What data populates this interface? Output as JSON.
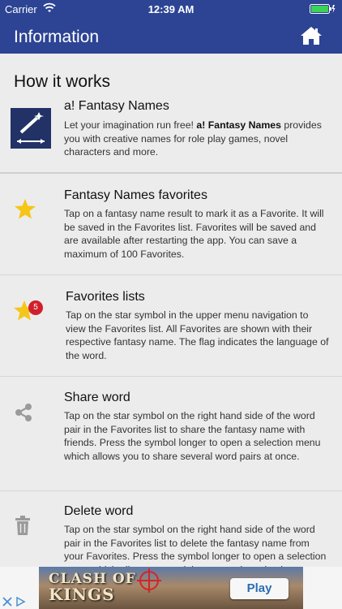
{
  "status": {
    "carrier": "Carrier",
    "time": "12:39 AM"
  },
  "nav": {
    "title": "Information",
    "home_icon": "home-icon"
  },
  "section_title": "How it works",
  "items": [
    {
      "icon": "magic-wand-app-icon",
      "heading": "a! Fantasy Names",
      "body_before": "Let your imagination run free! ",
      "body_bold": "a! Fantasy Names",
      "body_after": " provides you with creative names for role play games, novel characters and more."
    },
    {
      "icon": "star-icon",
      "heading": "Fantasy Names favorites",
      "body": "Tap on a fantasy name result to mark it as a Favorite. It will be saved in the Favorites list. Favorites will be saved and are available after restarting the app. You can save a maximum of 100 Favorites."
    },
    {
      "icon": "star-badge-icon",
      "badge": "5",
      "heading": "Favorites lists",
      "body": "Tap on the star symbol in the upper menu navigation to view the Favorites list. All Favorites are shown with their respective fantasy name. The flag indicates the language of the word."
    },
    {
      "icon": "share-icon",
      "heading": "Share word",
      "body": "Tap on the star symbol on the right hand side of the word pair in the Favorites list to share the fantasy name with friends. Press the symbol longer to open a selection menu which allows you to share several word pairs at once."
    },
    {
      "icon": "trash-icon",
      "heading": "Delete word",
      "body": "Tap on the star symbol on the right hand side of the word pair in the Favorites list to delete the fantasy name from your Favorites. Press the symbol longer to open a selection menu which allows you to delete several word pairs at once."
    }
  ],
  "ad": {
    "game_line1": "CLASH OF",
    "game_line2": "KINGS",
    "play_label": "Play"
  },
  "colors": {
    "nav": "#2d4494",
    "star": "#f5c518",
    "badge": "#d0202b",
    "icon_gray": "#9a9a9a"
  }
}
